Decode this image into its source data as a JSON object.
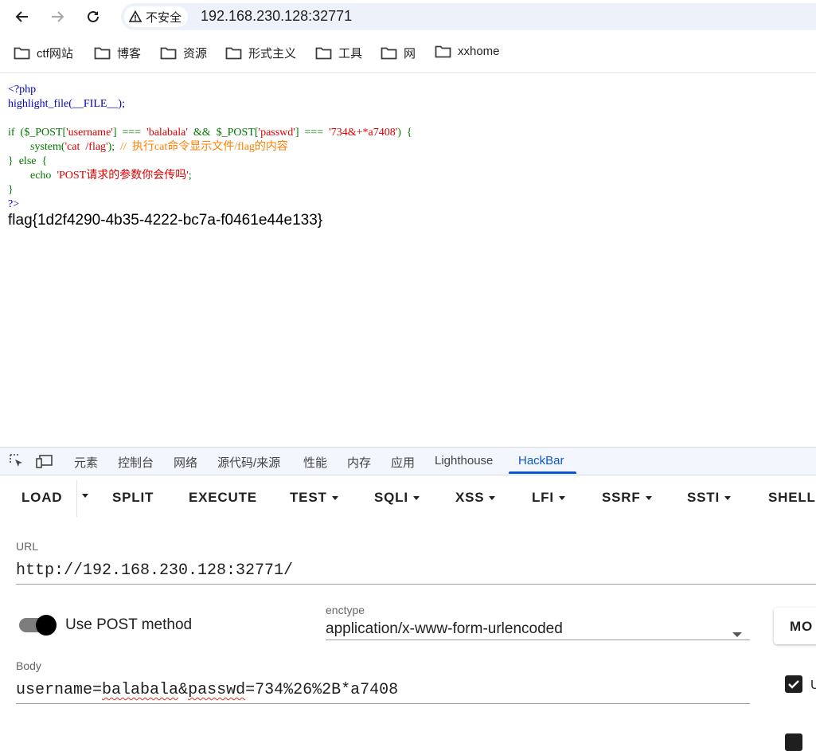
{
  "browser": {
    "security_label": "不安全",
    "url": "192.168.230.128:32771",
    "bookmarks": [
      "ctf网站",
      "博客",
      "资源",
      "形式主义",
      "工具",
      "网",
      "xxhome"
    ]
  },
  "page": {
    "code": {
      "l1": "<?php",
      "l2": "highlight_file(__FILE__);",
      "l4_a": "if  ($_POST[",
      "l4_b": "'username'",
      "l4_c": "]  ===  ",
      "l4_d": "'balabala'",
      "l4_e": "  &&  $_POST[",
      "l4_f": "'passwd'",
      "l4_g": "]  ===  ",
      "l4_h": "'734&+*a7408'",
      "l4_i": ")  {",
      "l5_a": "        system(",
      "l5_b": "'cat  /flag'",
      "l5_c": ");  ",
      "l5_d": "//  执行cat命令显示文件/flag的内容",
      "l6": "}  else  {",
      "l7_a": "        echo  ",
      "l7_b": "'POST请求的参数你会传吗'",
      "l7_c": ";",
      "l8": "}",
      "l9": "?>"
    },
    "flag": "flag{1d2f4290-4b35-4222-bc7a-f0461e44e133}"
  },
  "devtools": {
    "tabs": [
      "元素",
      "控制台",
      "网络",
      "源代码/来源",
      "性能",
      "内存",
      "应用",
      "Lighthouse",
      "HackBar"
    ],
    "active_tab": "HackBar"
  },
  "hackbar": {
    "buttons": {
      "load": "LOAD",
      "split": "SPLIT",
      "execute": "EXECUTE",
      "test": "TEST",
      "sqli": "SQLI",
      "xss": "XSS",
      "lfi": "LFI",
      "ssrf": "SSRF",
      "ssti": "SSTI",
      "shell": "SHELL"
    },
    "url_label": "URL",
    "url_value": "http://192.168.230.128:32771/",
    "post_label": "Use POST method",
    "post_enabled": true,
    "enctype_label": "enctype",
    "enctype_value": "application/x-www-form-urlencoded",
    "mode_button": "MO",
    "body_label": "Body",
    "body_a": "username=",
    "body_b": "balabala",
    "body_c": "&",
    "body_d": "passwd",
    "body_e": "=734%26%2B*a7408",
    "side_label": "U"
  },
  "colors": {
    "accent": "#0b57d0",
    "php_default": "#0000bb",
    "php_keyword": "#007700",
    "php_string": "#dd0000",
    "php_comment": "#ff8000"
  }
}
